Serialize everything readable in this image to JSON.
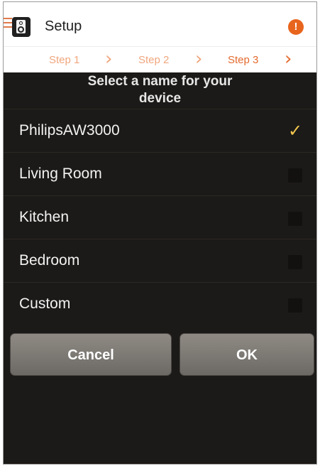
{
  "header": {
    "title": "Setup",
    "alert_glyph": "!"
  },
  "steps": {
    "items": [
      {
        "label": "Step 1",
        "current": false
      },
      {
        "label": "Step 2",
        "current": false
      },
      {
        "label": "Step 3",
        "current": true
      }
    ],
    "chevron_glyph": "›"
  },
  "prompt": {
    "line1": "Select a name for your",
    "line2": "device"
  },
  "names": [
    {
      "label": "PhilipsAW3000",
      "checked": true
    },
    {
      "label": "Living Room",
      "checked": false
    },
    {
      "label": "Kitchen",
      "checked": false
    },
    {
      "label": "Bedroom",
      "checked": false
    },
    {
      "label": "Custom",
      "checked": false
    }
  ],
  "check_glyph": "✓",
  "actions": {
    "cancel_label": "Cancel",
    "ok_label": "OK"
  },
  "colors": {
    "accent": "#e46a2e",
    "check": "#f3c64e",
    "background": "#1c1a18"
  },
  "icons": {
    "menu": "hamburger-icon",
    "app": "speaker-app-icon",
    "alert": "alert-icon",
    "chevron": "chevron-right-icon",
    "check": "checkmark-icon"
  }
}
